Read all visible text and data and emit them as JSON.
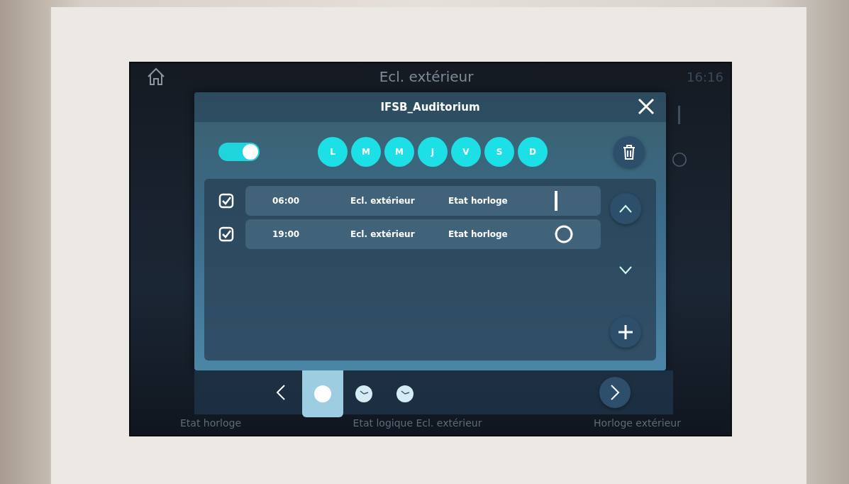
{
  "screen": {
    "title": "Ecl. extérieur",
    "time": "16:16",
    "background_labels": [
      "Etat horloge",
      "Etat logique Ecl. extérieur",
      "Horloge extérieur"
    ]
  },
  "dialog": {
    "title": "IFSB_Auditorium",
    "enabled": true,
    "days": [
      {
        "label": "L",
        "selected": true
      },
      {
        "label": "M",
        "selected": true
      },
      {
        "label": "M",
        "selected": true
      },
      {
        "label": "J",
        "selected": true
      },
      {
        "label": "V",
        "selected": true
      },
      {
        "label": "S",
        "selected": true
      },
      {
        "label": "D",
        "selected": true
      }
    ],
    "entries": [
      {
        "checked": true,
        "time": "06:00",
        "target": "Ecl. extérieur",
        "function": "Etat horloge",
        "on": true
      },
      {
        "checked": true,
        "time": "19:00",
        "target": "Ecl. extérieur",
        "function": "Etat horloge",
        "on": false
      }
    ],
    "pages": [
      {
        "kind": "dot",
        "selected": true
      },
      {
        "kind": "clock",
        "selected": false
      },
      {
        "kind": "clock",
        "selected": false
      }
    ]
  }
}
